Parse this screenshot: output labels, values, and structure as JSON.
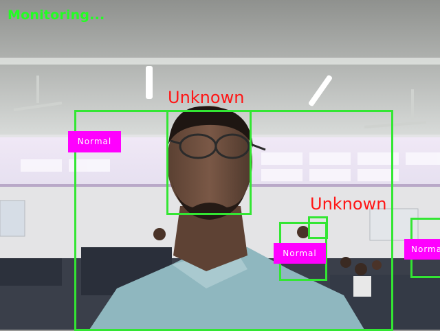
{
  "status_text": "Monitoring...",
  "colors": {
    "box": "#33e633",
    "status": "#22ff22",
    "unknown_label": "#ff1515",
    "normal_tag_bg": "#ff00ff",
    "normal_tag_text": "#ffffff"
  },
  "person_boxes": [
    {
      "label": "Normal"
    },
    {
      "label": "Normal"
    },
    {
      "label": "Normal"
    }
  ],
  "face_boxes": [
    {
      "label": "Unknown"
    },
    {
      "label": "Unknown"
    }
  ]
}
